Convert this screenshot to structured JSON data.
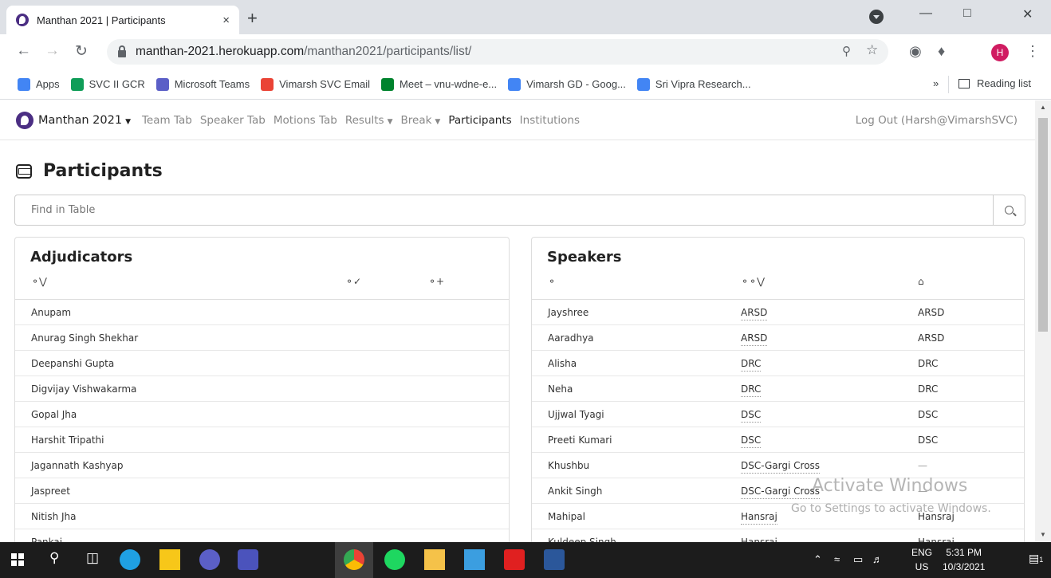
{
  "browser": {
    "tab_title": "Manthan 2021 | Participants",
    "tab_close": "×",
    "new_tab": "+",
    "url_host": "manthan-2021.herokuapp.com",
    "url_path": "/manthan2021/participants/list/",
    "avatar_letter": "H",
    "bookmarks": [
      {
        "label": "Apps",
        "color": "#4285f4"
      },
      {
        "label": "SVC II GCR",
        "color": "#0f9d58"
      },
      {
        "label": "Microsoft Teams",
        "color": "#5b5fc7"
      },
      {
        "label": "Vimarsh SVC Email",
        "color": "#ea4335"
      },
      {
        "label": "Meet – vnu-wdne-e...",
        "color": "#00832d"
      },
      {
        "label": "Vimarsh GD - Goog...",
        "color": "#4285f4"
      },
      {
        "label": "Sri Vipra Research...",
        "color": "#4285f4"
      }
    ],
    "bookmarks_more": "»",
    "reading_list": "Reading list"
  },
  "site_nav": {
    "brand": "Manthan 2021",
    "items": [
      "Team Tab",
      "Speaker Tab",
      "Motions Tab",
      "Results",
      "Break",
      "Participants",
      "Institutions"
    ],
    "logout": "Log Out (Harsh@VimarshSVC)"
  },
  "page": {
    "title": "Participants",
    "search_placeholder": "Find in Table"
  },
  "adjudicators": {
    "title": "Adjudicators",
    "rows": [
      "Anupam",
      "Anurag Singh Shekhar",
      "Deepanshi Gupta",
      "Digvijay Vishwakarma",
      "Gopal Jha",
      "Harshit Tripathi",
      "Jagannath Kashyap",
      "Jaspreet",
      "Nitish Jha",
      "Pankaj"
    ]
  },
  "speakers": {
    "title": "Speakers",
    "rows": [
      {
        "name": "Jayshree",
        "team": "ARSD",
        "institution": "ARSD"
      },
      {
        "name": "Aaradhya",
        "team": "ARSD",
        "institution": "ARSD"
      },
      {
        "name": "Alisha",
        "team": "DRC",
        "institution": "DRC"
      },
      {
        "name": "Neha",
        "team": "DRC",
        "institution": "DRC"
      },
      {
        "name": "Ujjwal Tyagi",
        "team": "DSC",
        "institution": "DSC"
      },
      {
        "name": "Preeti Kumari",
        "team": "DSC",
        "institution": "DSC"
      },
      {
        "name": "Khushbu",
        "team": "DSC-Gargi Cross",
        "institution": "—"
      },
      {
        "name": "Ankit Singh",
        "team": "DSC-Gargi Cross",
        "institution": "—"
      },
      {
        "name": "Mahipal",
        "team": "Hansraj",
        "institution": "Hansraj"
      },
      {
        "name": "Kuldeep Singh",
        "team": "Hansraj",
        "institution": "Hansraj"
      }
    ]
  },
  "watermark": {
    "line1": "Activate Windows",
    "line2": "Go to Settings to activate Windows."
  },
  "taskbar": {
    "lang1": "ENG",
    "lang2": "US",
    "time": "5:31 PM",
    "date": "10/3/2021",
    "notif_count": "1"
  }
}
